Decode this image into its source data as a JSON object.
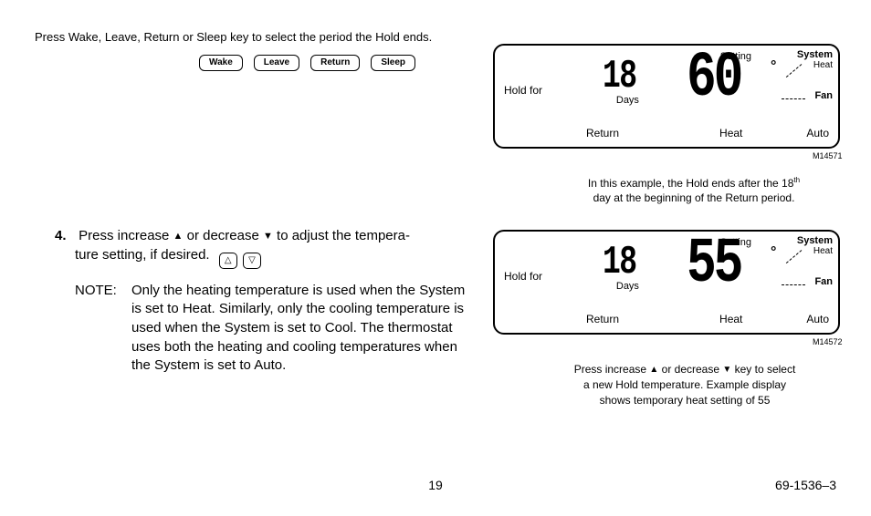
{
  "intro_text": "Press Wake, Leave, Return or Sleep key to select the period the Hold ends.",
  "period_keys": {
    "wake": "Wake",
    "leave": "Leave",
    "return": "Return",
    "sleep": "Sleep"
  },
  "panel1": {
    "setting_label": "Setting",
    "hold_for": "Hold for",
    "days_num": "18",
    "days_label": "Days",
    "temp": "60",
    "period": "Return",
    "mode": "Heat",
    "fan_mode": "Auto",
    "system_label": "System",
    "system_mode": "Heat",
    "fan_label": "Fan",
    "fig_id": "M14571"
  },
  "caption1": {
    "line1_a": "In this example, the Hold ends after the 18",
    "line1_sup": "th",
    "line2": "day at the beginning of the Return period."
  },
  "panel2": {
    "setting_label": "Setting",
    "hold_for": "Hold for",
    "days_num": "18",
    "days_label": "Days",
    "temp": "55",
    "period": "Return",
    "mode": "Heat",
    "fan_mode": "Auto",
    "system_label": "System",
    "system_mode": "Heat",
    "fan_label": "Fan",
    "fig_id": "M14572"
  },
  "caption2": {
    "line1_a": "Press increase ",
    "line1_b": " or decrease ",
    "line1_c": " key to select",
    "line2": "a new Hold temperature. Example display",
    "line3": "shows temporary heat setting of 55"
  },
  "step4": {
    "number": "4.",
    "text_a": "Press increase ",
    "text_b": " or decrease ",
    "text_c": " to adjust the tempera-",
    "text_d": "ture setting, if desired."
  },
  "note": {
    "label": "NOTE:",
    "body": "Only the heating temperature is used when the System is set to Heat. Similarly, only the cooling temperature is used when the System is set to Cool. The thermostat uses both the heating and cooling temperatures when the System is set to Auto."
  },
  "page_number": "19",
  "doc_id": "69-1536–3"
}
